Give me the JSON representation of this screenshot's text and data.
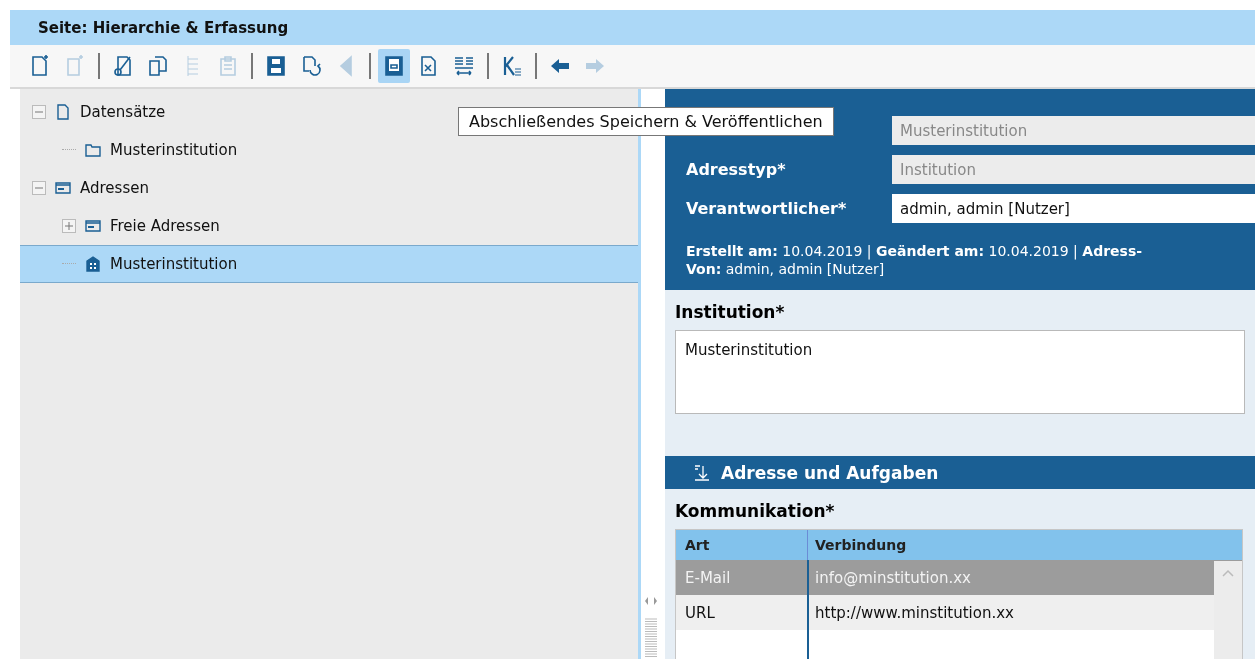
{
  "page_title": "Seite: Hierarchie & Erfassung",
  "toolbar": [
    {
      "kind": "new-document",
      "disabled": false,
      "selected": false
    },
    {
      "kind": "new-child",
      "disabled": true,
      "selected": false
    },
    {
      "kind": "separator"
    },
    {
      "kind": "cut",
      "disabled": false,
      "selected": false
    },
    {
      "kind": "copy",
      "disabled": false,
      "selected": false
    },
    {
      "kind": "tree",
      "disabled": true,
      "selected": false
    },
    {
      "kind": "paste",
      "disabled": true,
      "selected": false
    },
    {
      "kind": "separator"
    },
    {
      "kind": "save",
      "disabled": false,
      "selected": false
    },
    {
      "kind": "redo",
      "disabled": false,
      "selected": false
    },
    {
      "kind": "back",
      "disabled": true,
      "selected": false
    },
    {
      "kind": "separator"
    },
    {
      "kind": "save-publish",
      "disabled": false,
      "selected": true
    },
    {
      "kind": "discard",
      "disabled": false,
      "selected": false
    },
    {
      "kind": "wrap",
      "disabled": false,
      "selected": false
    },
    {
      "kind": "separator"
    },
    {
      "kind": "k-list",
      "disabled": false,
      "selected": false
    },
    {
      "kind": "separator"
    },
    {
      "kind": "arrow-left",
      "disabled": false,
      "selected": false
    },
    {
      "kind": "arrow-right",
      "disabled": true,
      "selected": false
    }
  ],
  "tooltip": "Abschließendes Speichern & Veröffentlichen",
  "tree": [
    {
      "label": "Datensätze",
      "kind": "document",
      "expanded": true,
      "selected": false,
      "children": [
        {
          "label": "Musterinstitution",
          "kind": "folder",
          "selected": false
        }
      ]
    },
    {
      "label": "Adressen",
      "kind": "card",
      "expanded": true,
      "selected": false,
      "children": [
        {
          "label": "Freie Adressen",
          "kind": "card",
          "expanded": false,
          "selected": false
        },
        {
          "label": "Musterinstitution",
          "kind": "building",
          "selected": true
        }
      ]
    }
  ],
  "header_fields": [
    {
      "value": "Musterinstitution",
      "disabled": true
    },
    {
      "label": "Adresstyp*",
      "value": "Institution",
      "disabled": true
    },
    {
      "label": "Verantwortlicher*",
      "value": "admin, admin [Nutzer]",
      "disabled": false
    }
  ],
  "meta_lines": [
    "**Erstellt am:** 10.04.2019 | **Geändert am:** 10.04.2019 | **Adress-**",
    "**Von:** admin, admin [Nutzer]"
  ],
  "institution": {
    "label": "Institution*",
    "value": "Musterinstitution"
  },
  "section": {
    "title": "Adresse und Aufgaben"
  },
  "communication": {
    "label": "Kommunikation*",
    "columns": [
      "Art",
      "Verbindung"
    ],
    "rows": [
      {
        "cells": [
          "E-Mail",
          "info@minstitution.xx"
        ],
        "selected": true
      },
      {
        "cells": [
          "URL",
          "http://www.minstitution.xx"
        ],
        "selected": false
      }
    ]
  }
}
